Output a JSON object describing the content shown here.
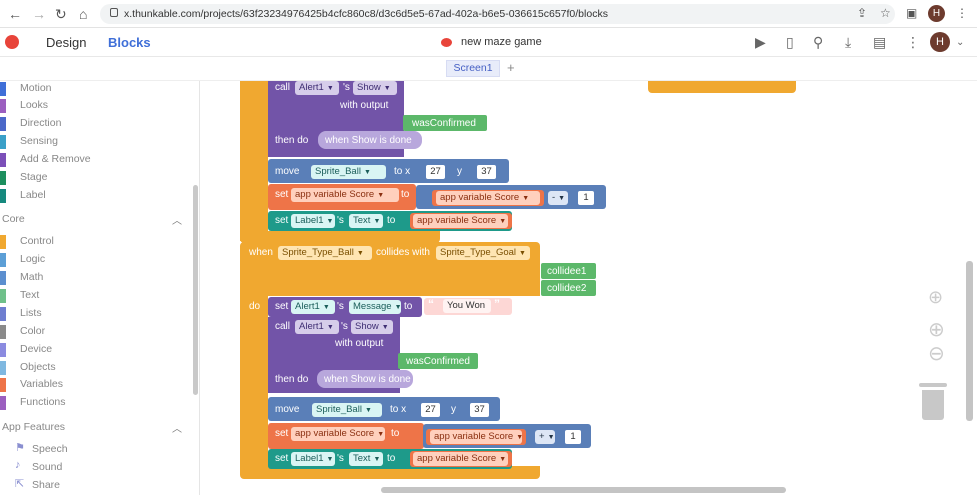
{
  "browser": {
    "url": "x.thunkable.com/projects/63f23234976425b4cfc860c8/d3c6d5e5-67ad-402a-b6e5-036615c657f0/blocks",
    "avatar_initial": "H"
  },
  "app": {
    "tabs": {
      "design": "Design",
      "blocks": "Blocks"
    },
    "project_name": "new maze game",
    "avatar_initial": "H",
    "screen_tab": "Screen1",
    "add_screen": "+"
  },
  "sidebar": {
    "sprite_categories": [
      {
        "label": "Motion",
        "color": "#3f6fd8"
      },
      {
        "label": "Looks",
        "color": "#9b5fbf"
      },
      {
        "label": "Direction",
        "color": "#4b68c9"
      },
      {
        "label": "Sensing",
        "color": "#3aa0c8"
      },
      {
        "label": "Add & Remove",
        "color": "#7b4fb8"
      },
      {
        "label": "Stage",
        "color": "#1d8f5e"
      },
      {
        "label": "Label",
        "color": "#16897e"
      }
    ],
    "core_title": "Core",
    "core_categories": [
      {
        "label": "Control",
        "color": "#f0a830"
      },
      {
        "label": "Logic",
        "color": "#5c9fd6"
      },
      {
        "label": "Math",
        "color": "#5c8fcf"
      },
      {
        "label": "Text",
        "color": "#6fc08a"
      },
      {
        "label": "Lists",
        "color": "#6e7ed0"
      },
      {
        "label": "Color",
        "color": "#8a8a8a"
      },
      {
        "label": "Device",
        "color": "#8b8be0"
      },
      {
        "label": "Objects",
        "color": "#7fb8e0"
      },
      {
        "label": "Variables",
        "color": "#ee7448"
      },
      {
        "label": "Functions",
        "color": "#9b5fbf"
      }
    ],
    "features_title": "App Features",
    "features": [
      {
        "label": "Speech",
        "icon": "speech-icon"
      },
      {
        "label": "Sound",
        "icon": "sound-icon"
      },
      {
        "label": "Share",
        "icon": "share-icon"
      }
    ]
  },
  "blocks": {
    "call": "call",
    "alert": "Alert1",
    "s_show": "'s",
    "show": "Show",
    "with_output": "with output",
    "was_confirmed": "wasConfirmed",
    "then_do": "then do",
    "when_show_done": "when Show is done",
    "move": "move",
    "sprite_ball": "Sprite_Ball",
    "to_x": "to x",
    "x_val": "27",
    "y_label": "y",
    "y_val": "37",
    "set": "set",
    "app_var_score": "app variable Score",
    "to": "to",
    "minus": "-",
    "plus": "+",
    "one": "1",
    "label1": "Label1",
    "s": "'s",
    "text": "Text",
    "when": "when",
    "sprite_type_ball": "Sprite_Type_Ball",
    "collides_with": "collides with",
    "sprite_type_goal": "Sprite_Type_Goal",
    "collidee1": "collidee1",
    "collidee2": "collidee2",
    "do": "do",
    "message": "Message",
    "you_won": "You Won"
  },
  "colors": {
    "control": "#f0a830",
    "device_purple": "#7254a8",
    "sprite_teal": "#1e9a8a",
    "motion_blue": "#5a7fb8",
    "variables_orange": "#ee7448",
    "text_green": "#5cb86a",
    "events_purple_light": "#b8a7dc",
    "text_pink": "#fdd7d5"
  }
}
